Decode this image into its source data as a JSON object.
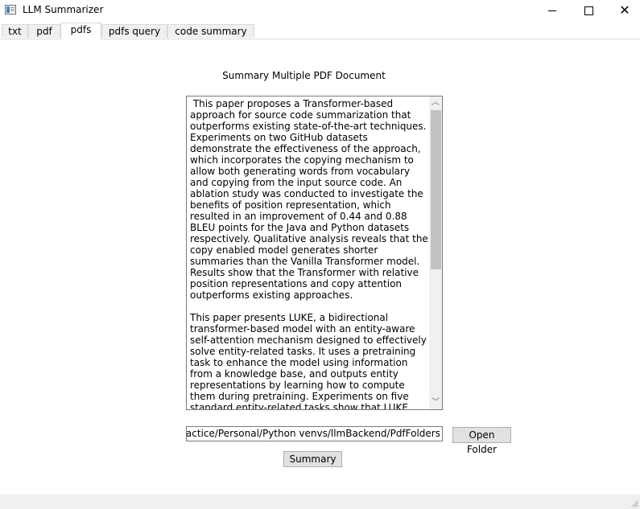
{
  "window": {
    "title": "LLM Summarizer",
    "minimize_icon": "minimize-icon",
    "maximize_icon": "maximize-icon",
    "close_icon": "close-icon",
    "close_glyph": "✕"
  },
  "tabs": [
    {
      "label": "txt",
      "active": false
    },
    {
      "label": "pdf",
      "active": false
    },
    {
      "label": "pdfs",
      "active": true
    },
    {
      "label": "pdfs query",
      "active": false
    },
    {
      "label": "code summary",
      "active": false
    }
  ],
  "main": {
    "heading": "Summary Multiple PDF Document",
    "summary_text": " This paper proposes a Transformer-based approach for source code summarization that outperforms existing state-of-the-art techniques. Experiments on two GitHub datasets demonstrate the effectiveness of the approach, which incorporates the copying mechanism to allow both generating words from vocabulary and copying from the input source code. An ablation study was conducted to investigate the benefits of position representation, which resulted in an improvement of 0.44 and 0.88 BLEU points for the Java and Python datasets respectively. Qualitative analysis reveals that the copy enabled model generates shorter summaries than the Vanilla Transformer model. Results show that the Transformer with relative position representations and copy attention outperforms existing approaches.\n\nThis paper presents LUKE, a bidirectional transformer-based model with an entity-aware self-attention mechanism designed to effectively solve entity-related tasks. It uses a pretraining task to enhance the model using information from a knowledge base, and outputs entity representations by learning how to compute them during pretraining. Experiments on five standard entity-related tasks show that LUKE outperforms all baseline models and obtains state-of-the-art",
    "scroll_up_glyph": "︿",
    "scroll_down_glyph": "﹀",
    "folder_path": "ractice/Personal/Python venvs/llmBackend/PdfFolders",
    "open_folder_label": "Open Folder",
    "summary_button_label": "Summary"
  }
}
